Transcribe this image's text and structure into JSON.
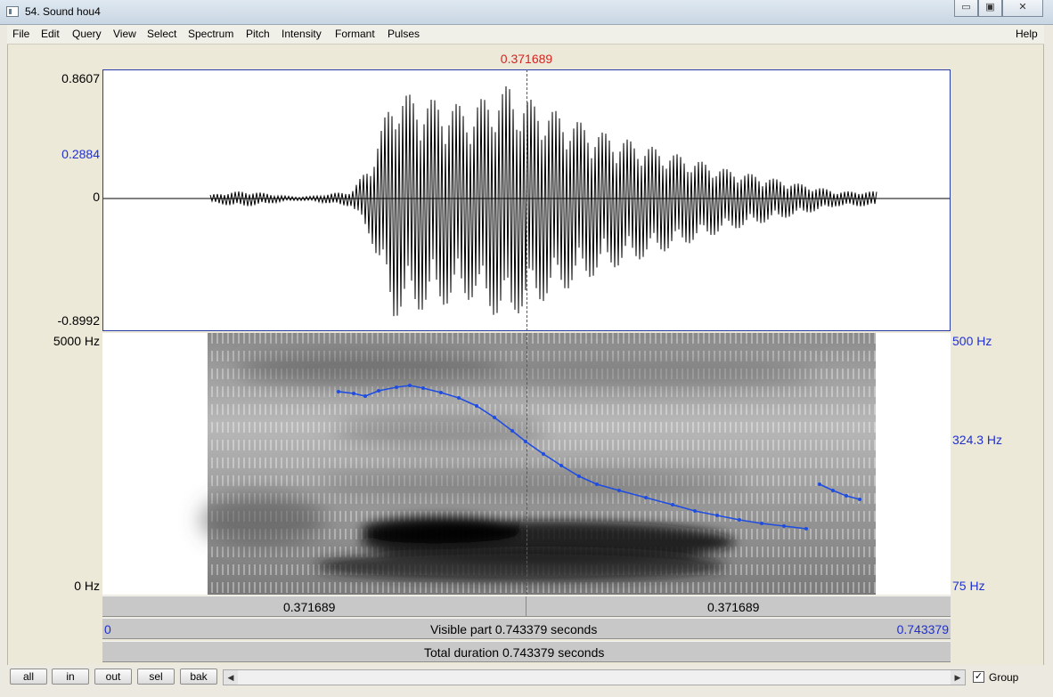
{
  "window": {
    "title": "54. Sound hou4",
    "controls": {
      "minimize": "▭",
      "maximize": "▣",
      "close": "✕"
    }
  },
  "menu": {
    "items": [
      "File",
      "Edit",
      "Query",
      "View",
      "Select",
      "Spectrum",
      "Pitch",
      "Intensity",
      "Formant",
      "Pulses"
    ],
    "help": "Help"
  },
  "cursor": {
    "time": "0.371689",
    "color": "#d6231f"
  },
  "waveform": {
    "y_max": "0.8607",
    "y_cursor": "0.2884",
    "y_zero": "0",
    "y_min": "-0.8992"
  },
  "spectrogram": {
    "freq_top": "5000 Hz",
    "freq_bottom": "0 Hz",
    "pitch_top": "500 Hz",
    "pitch_mid": "324.3 Hz",
    "pitch_bottom": "75 Hz"
  },
  "time_bar": {
    "left_segment": "0.371689",
    "right_segment": "0.371689",
    "start": "0",
    "end": "0.743379",
    "visible_part": "Visible part 0.743379 seconds",
    "total_duration": "Total duration 0.743379 seconds"
  },
  "buttons": {
    "all": "all",
    "in": "in",
    "out": "out",
    "sel": "sel",
    "bak": "bak"
  },
  "group": {
    "label": "Group",
    "checked": true,
    "check_glyph": "✓"
  },
  "colors": {
    "pitch_curve": "#1f4de0",
    "axis_blue": "#2030d0",
    "cursor_red": "#d6231f"
  }
}
